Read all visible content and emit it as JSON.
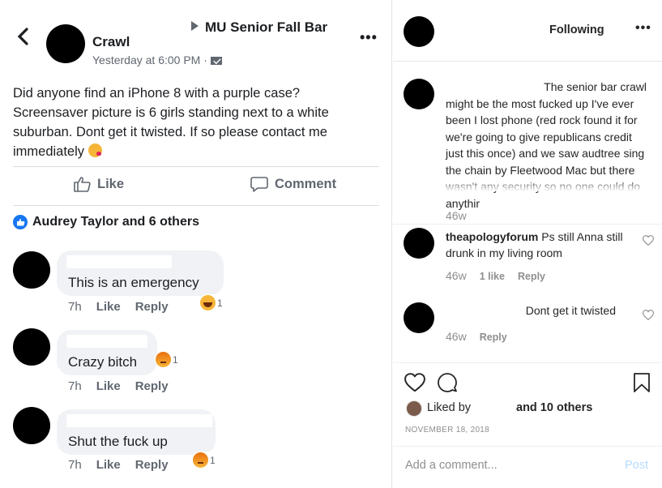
{
  "facebook": {
    "back_icon": "chevron-left-icon",
    "author_name": "Crawl",
    "group_name": "MU Senior Fall Bar",
    "timestamp": "Yesterday at 6:00 PM ·",
    "audience_icon": "envelope-icon",
    "more_icon": "•••",
    "post_lines": [
      "Did anyone find an iPhone 8 with a purple case?",
      "Screensaver picture is 6 girls standing next to a white",
      "suburban. Dont get it twisted.  If so please contact me",
      "immediately"
    ],
    "like_label": "Like",
    "comment_label": "Comment",
    "reactions_summary": "Audrey Taylor and 6 others",
    "comments": [
      {
        "text": "This is an emergency",
        "age": "7h",
        "like": "Like",
        "reply": "Reply",
        "reaction": "laugh-emoji",
        "reaction_count": "1"
      },
      {
        "text": "Crazy bitch",
        "age": "7h",
        "like": "Like",
        "reply": "Reply",
        "reaction": "angry-emoji",
        "reaction_count": "1"
      },
      {
        "text": "Shut the fuck up",
        "age": "7h",
        "like": "Like",
        "reply": "Reply",
        "reaction": "angry-emoji",
        "reaction_count": "1"
      }
    ]
  },
  "instagram": {
    "following_label": "Following",
    "more_icon": "•••",
    "caption_lines": [
      "The senior bar crawl",
      "might be the most fucked up I've ever",
      "been I lost phone (red rock found it for",
      "we're going to give republicans credit",
      "just this once) and we saw audtree sing",
      "the chain by Fleetwood Mac but there",
      "wasn't any security so no one could do",
      "anythir"
    ],
    "caption_age": "46w",
    "comments": [
      {
        "username": "theapologyforum",
        "text": "Ps still Anna still drunk in my living room",
        "age": "46w",
        "likes": "1 like",
        "reply": "Reply"
      },
      {
        "username": "",
        "text": "Dont get it twisted",
        "age": "46w",
        "likes": "",
        "reply": "Reply"
      }
    ],
    "liked_by_label": "Liked by",
    "liked_by_others": "and 10 others",
    "date": "NOVEMBER 18, 2018",
    "add_comment_placeholder": "Add a comment...",
    "post_label": "Post",
    "colors": {
      "post_disabled": "#b3dbff",
      "meta_gray": "#8e8e8e",
      "fb_blue": "#1877f2"
    }
  }
}
